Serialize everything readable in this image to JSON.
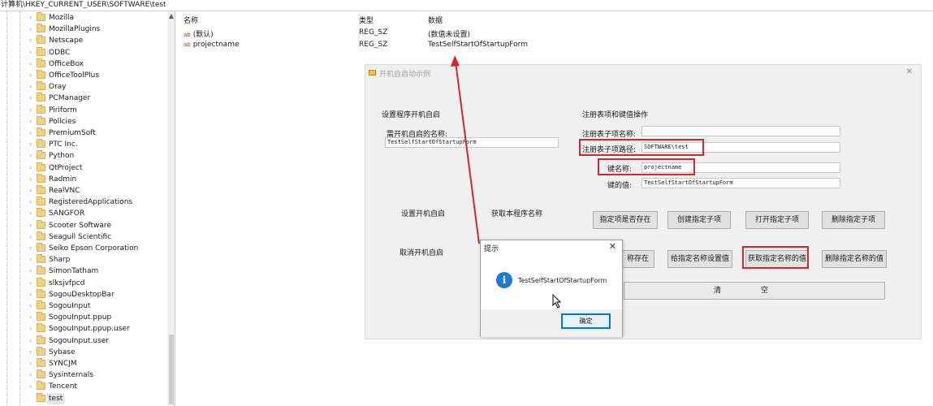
{
  "address_bar": "计算机\\HKEY_CURRENT_USER\\SOFTWARE\\test",
  "tree": {
    "items": [
      {
        "label": "Mozilla"
      },
      {
        "label": "MozillaPlugins"
      },
      {
        "label": "Netscape"
      },
      {
        "label": "ODBC"
      },
      {
        "label": "OfficeBox"
      },
      {
        "label": "OfficeToolPlus"
      },
      {
        "label": "Oray"
      },
      {
        "label": "PCManager"
      },
      {
        "label": "Piriform"
      },
      {
        "label": "Policies"
      },
      {
        "label": "PremiumSoft"
      },
      {
        "label": "PTC Inc."
      },
      {
        "label": "Python"
      },
      {
        "label": "QtProject"
      },
      {
        "label": "Radmin"
      },
      {
        "label": "RealVNC"
      },
      {
        "label": "RegisteredApplications"
      },
      {
        "label": "SANGFOR"
      },
      {
        "label": "Scooter Software"
      },
      {
        "label": "Seagull Scientific"
      },
      {
        "label": "Seiko Epson Corporation"
      },
      {
        "label": "Sharp"
      },
      {
        "label": "SimonTatham"
      },
      {
        "label": "slksjvfpcd"
      },
      {
        "label": "SogouDesktopBar"
      },
      {
        "label": "SogouInput"
      },
      {
        "label": "SogouInput.ppup"
      },
      {
        "label": "SogouInput.ppup.user"
      },
      {
        "label": "SogouInput.user"
      },
      {
        "label": "Sybase"
      },
      {
        "label": "SYNCJM"
      },
      {
        "label": "Sysinternals"
      },
      {
        "label": "Tencent"
      },
      {
        "label": "test"
      }
    ]
  },
  "values_pane": {
    "headers": {
      "name": "名称",
      "type": "类型",
      "data": "数据"
    },
    "rows": [
      {
        "icon": "ab",
        "name": "(默认)",
        "type": "REG_SZ",
        "data": "(数值未设置)"
      },
      {
        "icon": "ab",
        "name": "projectname",
        "type": "REG_SZ",
        "data": "TestSelfStartOfStartupForm"
      }
    ]
  },
  "app_window": {
    "title": "开机自启动示例",
    "left_group": {
      "title": "设置程序开机自启",
      "name_label": "需开机自启的名称:",
      "name_value": "TestSelfStartOfStartupForm",
      "set_autostart_button": "设置开机自启",
      "get_name_button": "获取本程序名称",
      "cancel_autostart_button": "取消开机自启"
    },
    "right_group": {
      "title": "注册表项和键值操作",
      "subkey_name_label": "注册表子项名称:",
      "subkey_name_value": "",
      "subkey_path_label": "注册表子项路径:",
      "subkey_path_value": "SOFTWARE\\test",
      "key_name_label": "键名称:",
      "key_name_value": "projectname",
      "key_value_label": "键的值:",
      "key_value_value": "TestSelfStartOfStartupForm",
      "check_exists_button": "指定项是否存在",
      "create_subkey_button": "创建指定子项",
      "open_subkey_button": "打开指定子项",
      "delete_subkey_button": "删除指定子项",
      "value_exists_button": "称存在",
      "set_value_button": "给指定名称设置值",
      "get_value_button": "获取指定名称的值",
      "delete_value_button": "删除指定名称的值",
      "clear_button_char1": "清",
      "clear_button_char2": "空"
    }
  },
  "dialog": {
    "title": "提示",
    "close": "✕",
    "message": "TestSelfStartOfStartupForm",
    "ok_button": "确定"
  },
  "colors": {
    "highlight_box": "#d92430",
    "info_icon": "#1e78d6"
  }
}
